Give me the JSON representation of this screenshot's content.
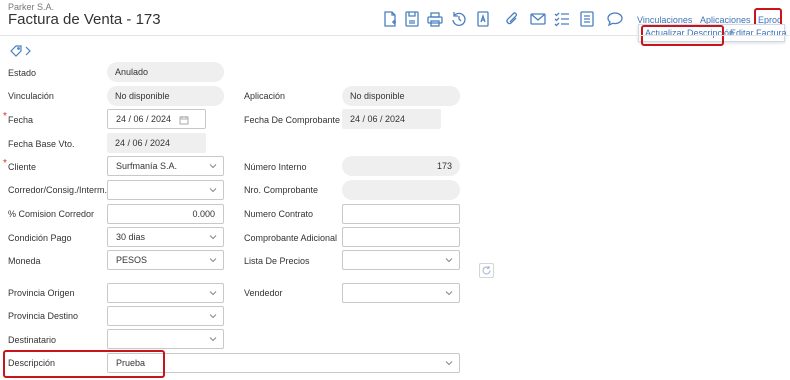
{
  "header": {
    "company": "Parker S.A.",
    "title": "Factura de Venta - 173"
  },
  "toolbar": {
    "icons": [
      "new-document-icon",
      "save-icon",
      "print-icon",
      "history-icon",
      "text-document-icon",
      "attach-icon",
      "email-icon",
      "checklist-icon",
      "notes-icon",
      "comment-icon"
    ],
    "links": {
      "vinculaciones": "Vinculaciones",
      "aplicaciones": "Aplicaciones",
      "eproc": "Eproc"
    },
    "dropdown": {
      "actualizar": "Actualizar Descripción",
      "editar": "Editar Factura"
    }
  },
  "form": {
    "estado": {
      "label": "Estado",
      "value": "Anulado"
    },
    "vinculacion": {
      "label": "Vinculación",
      "value": "No disponible"
    },
    "aplicacion": {
      "label": "Aplicación",
      "value": "No disponible"
    },
    "fecha": {
      "label": "Fecha",
      "value": "24 / 06 / 2024",
      "required": "*"
    },
    "fecha_comprobante": {
      "label": "Fecha De Comprobante",
      "value": "24 / 06 / 2024"
    },
    "fecha_base": {
      "label": "Fecha Base Vto.",
      "value": "24 / 06 / 2024"
    },
    "cliente": {
      "label": "Cliente",
      "value": "Surfmanía S.A.",
      "required": "*"
    },
    "numero_interno": {
      "label": "Número Interno",
      "value": "173"
    },
    "corredor": {
      "label": "Corredor/Consig./Interm.",
      "value": ""
    },
    "nro_comprobante": {
      "label": "Nro. Comprobante",
      "value": ""
    },
    "comision": {
      "label": "% Comision Corredor",
      "value": "0.000"
    },
    "numero_contrato": {
      "label": "Numero Contrato",
      "value": ""
    },
    "condicion_pago": {
      "label": "Condición Pago",
      "value": "30 dias"
    },
    "comprobante_adicional": {
      "label": "Comprobante Adicional",
      "value": ""
    },
    "moneda": {
      "label": "Moneda",
      "value": "PESOS"
    },
    "lista_precios": {
      "label": "Lista De Precios",
      "value": ""
    },
    "provincia_origen": {
      "label": "Provincia Origen",
      "value": ""
    },
    "vendedor": {
      "label": "Vendedor",
      "value": ""
    },
    "provincia_destino": {
      "label": "Provincia Destino",
      "value": ""
    },
    "destinatario": {
      "label": "Destinatario",
      "value": ""
    },
    "descripcion": {
      "label": "Descripción",
      "value": "Prueba"
    }
  },
  "colors": {
    "accent": "#3c74b8",
    "highlight": "#c8151b",
    "readonly_bg": "#efefef"
  }
}
